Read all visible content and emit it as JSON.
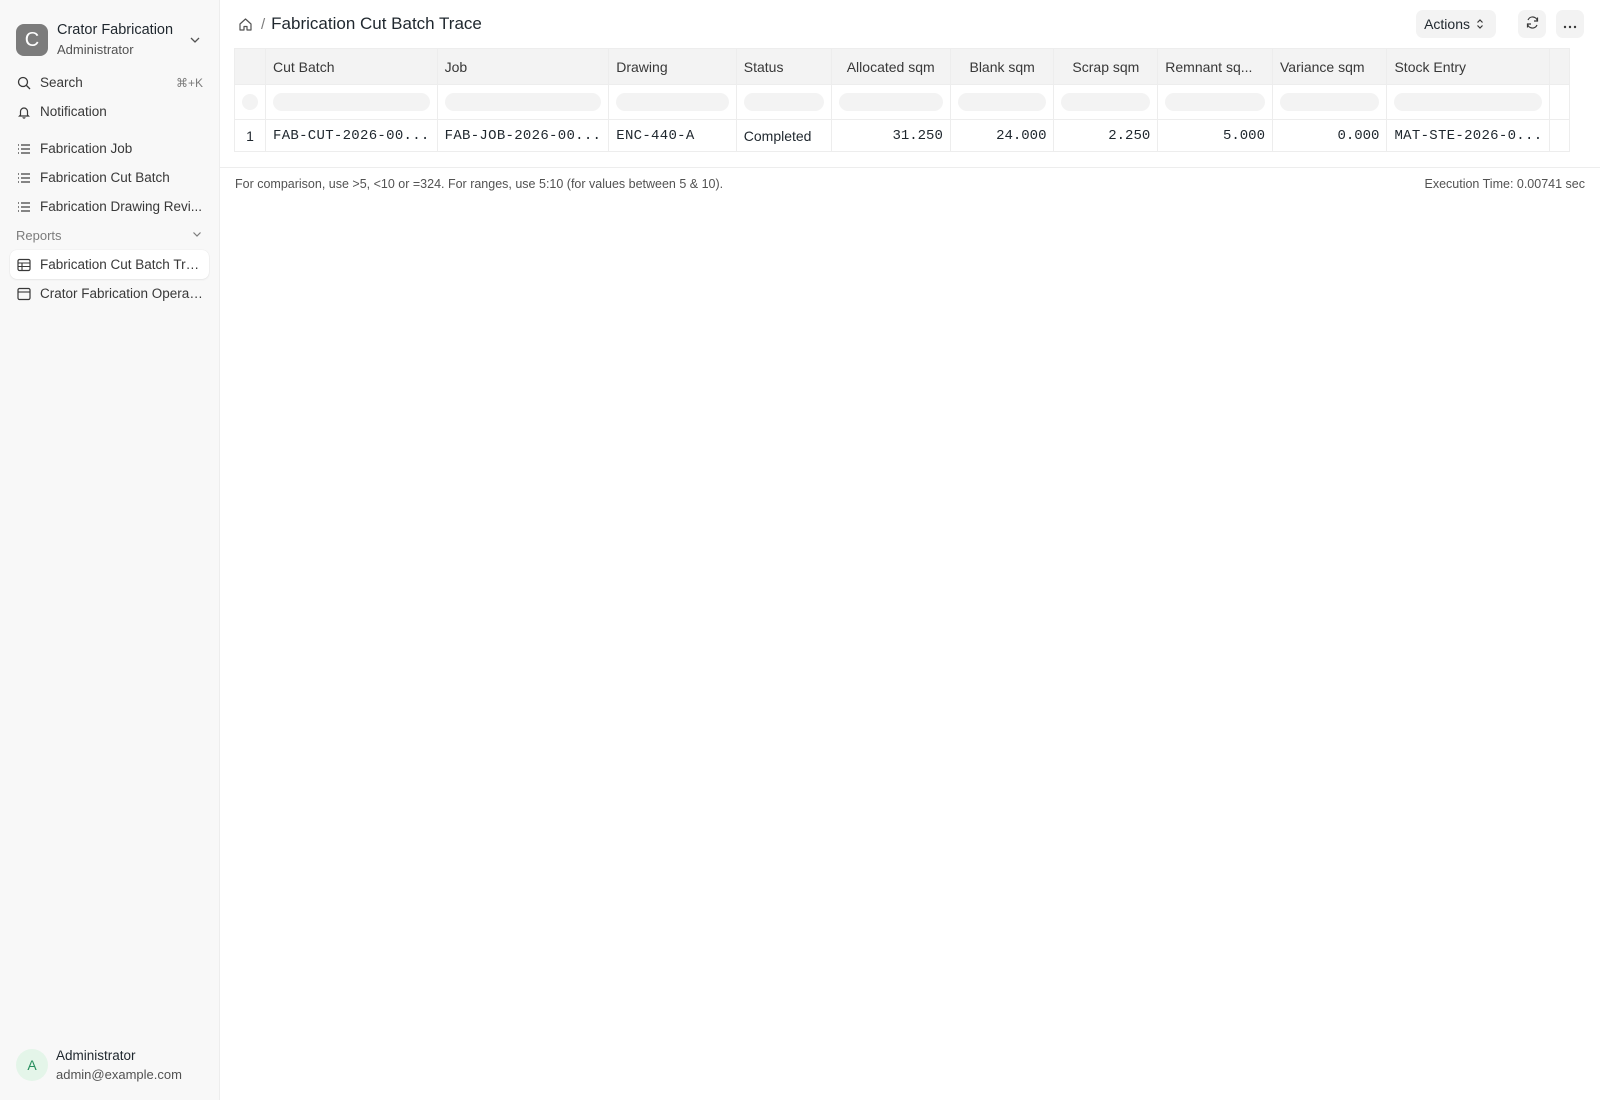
{
  "workspace": {
    "initial": "C",
    "name": "Crator Fabrication",
    "role": "Administrator"
  },
  "sidebar": {
    "search": {
      "label": "Search",
      "shortcut": "⌘+K"
    },
    "notification": {
      "label": "Notification"
    },
    "items": [
      {
        "label": "Fabrication Job"
      },
      {
        "label": "Fabrication Cut Batch"
      },
      {
        "label": "Fabrication Drawing Revi..."
      }
    ],
    "reports_label": "Reports",
    "reports": [
      {
        "label": "Fabrication Cut Batch Tra..."
      },
      {
        "label": "Crator Fabrication Operat..."
      }
    ]
  },
  "user": {
    "initial": "A",
    "name": "Administrator",
    "email": "admin@example.com"
  },
  "page": {
    "title": "Fabrication Cut Batch Trace",
    "actions_label": "Actions"
  },
  "table": {
    "columns": [
      "Cut Batch",
      "Job",
      "Drawing",
      "Status",
      "Allocated sqm",
      "Blank sqm",
      "Scrap sqm",
      "Remnant sq...",
      "Variance sqm",
      "Stock Entry"
    ],
    "rows": [
      {
        "index": "1",
        "cells": [
          "FAB-CUT-2026-00...",
          "FAB-JOB-2026-00...",
          "ENC-440-A",
          "Completed",
          "31.250",
          "24.000",
          "2.250",
          "5.000",
          "0.000",
          "MAT-STE-2026-0..."
        ]
      }
    ]
  },
  "footer": {
    "hint": "For comparison, use >5, <10 or =324. For ranges, use 5:10 (for values between 5 & 10).",
    "execution_time": "Execution Time: 0.00741 sec"
  }
}
